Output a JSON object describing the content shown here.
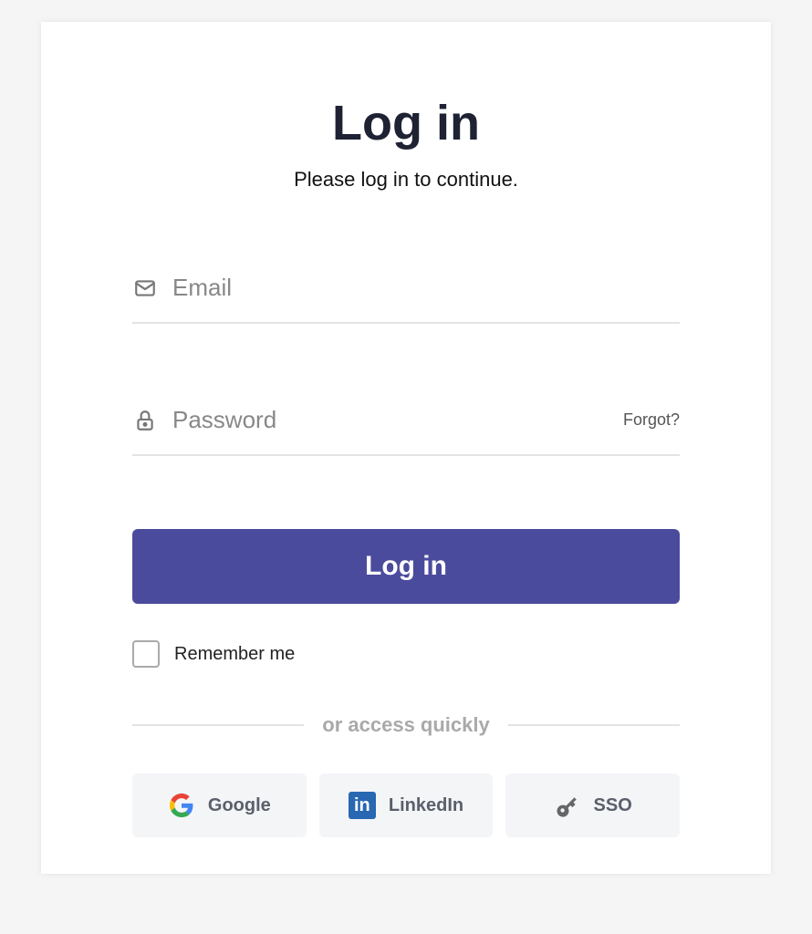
{
  "heading": "Log in",
  "subheading": "Please log in to continue.",
  "email": {
    "placeholder": "Email",
    "value": ""
  },
  "password": {
    "placeholder": "Password",
    "value": "",
    "forgot_label": "Forgot?"
  },
  "submit_label": "Log in",
  "remember_label": "Remember me",
  "divider_label": "or access quickly",
  "social": {
    "google": "Google",
    "linkedin": "LinkedIn",
    "sso": "SSO"
  }
}
